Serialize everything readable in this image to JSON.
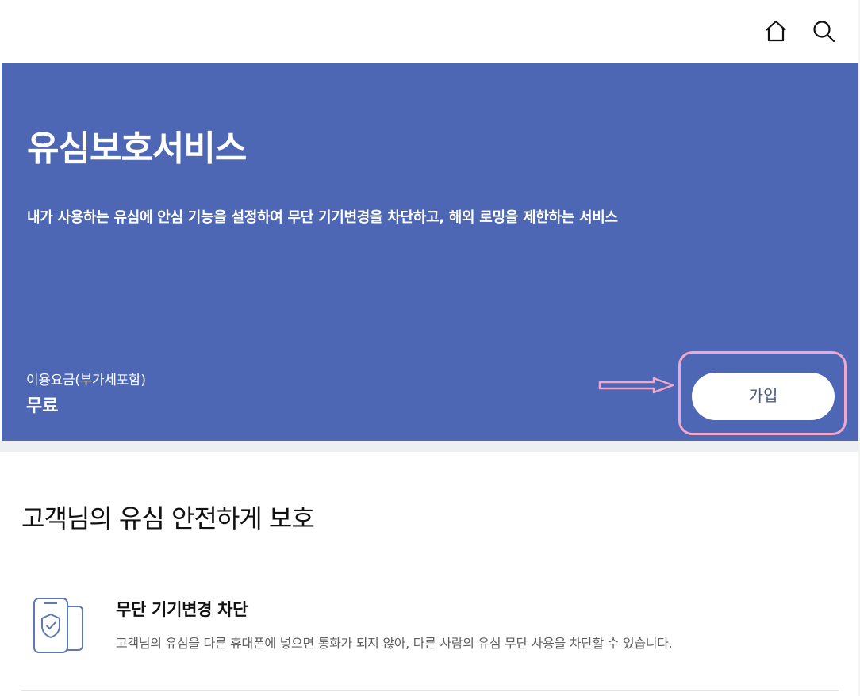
{
  "header": {
    "home_icon": "home-icon",
    "search_icon": "search-icon"
  },
  "hero": {
    "title": "유심보호서비스",
    "description": "내가 사용하는 유심에 안심 기능을 설정하여 무단 기기변경을 차단하고, 해외 로밍을 제한하는 서비스",
    "fee_label": "이용요금(부가세포함)",
    "fee_value": "무료",
    "join_label": "가입",
    "background_color": "#4d67b5",
    "highlight_color": "#f2a6c9"
  },
  "content": {
    "section_title": "고객님의 유심 안전하게 보호",
    "features": [
      {
        "icon": "phone-shield-icon",
        "title": "무단 기기변경 차단",
        "description": "고객님의 유심을 다른 휴대폰에 넣으면 통화가 되지 않아, 다른 사람의 유심 무단 사용을 차단할 수 있습니다."
      }
    ]
  }
}
